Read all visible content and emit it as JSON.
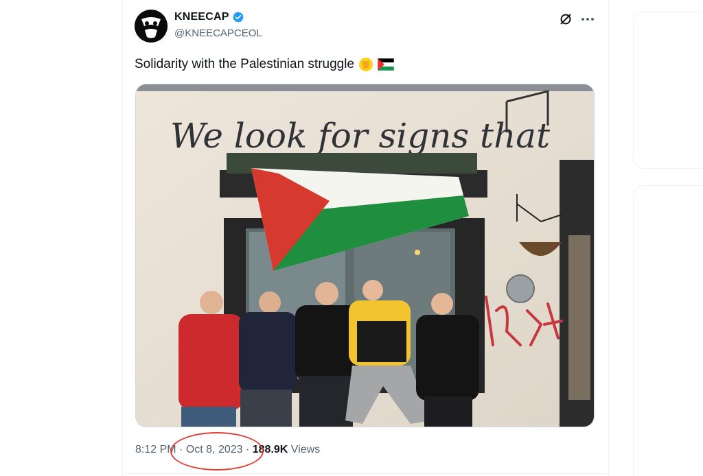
{
  "tweet": {
    "display_name": "KNEECAP",
    "handle": "@KNEECAPCEOL",
    "text": "Solidarity with the Palestinian struggle",
    "emojis": [
      "raised-fist-emoji",
      "palestine-flag-emoji"
    ],
    "verified": true
  },
  "media": {
    "wall_sign": "We look for signs that"
  },
  "meta": {
    "time": "8:12 PM",
    "separator": " · ",
    "date": "Oct 8, 2023",
    "views_count": "188.9K",
    "views_label": " Views"
  },
  "colors": {
    "verified_blue": "#1d9bf0",
    "secondary_text": "#536471",
    "annotation_red": "#e0413b"
  }
}
